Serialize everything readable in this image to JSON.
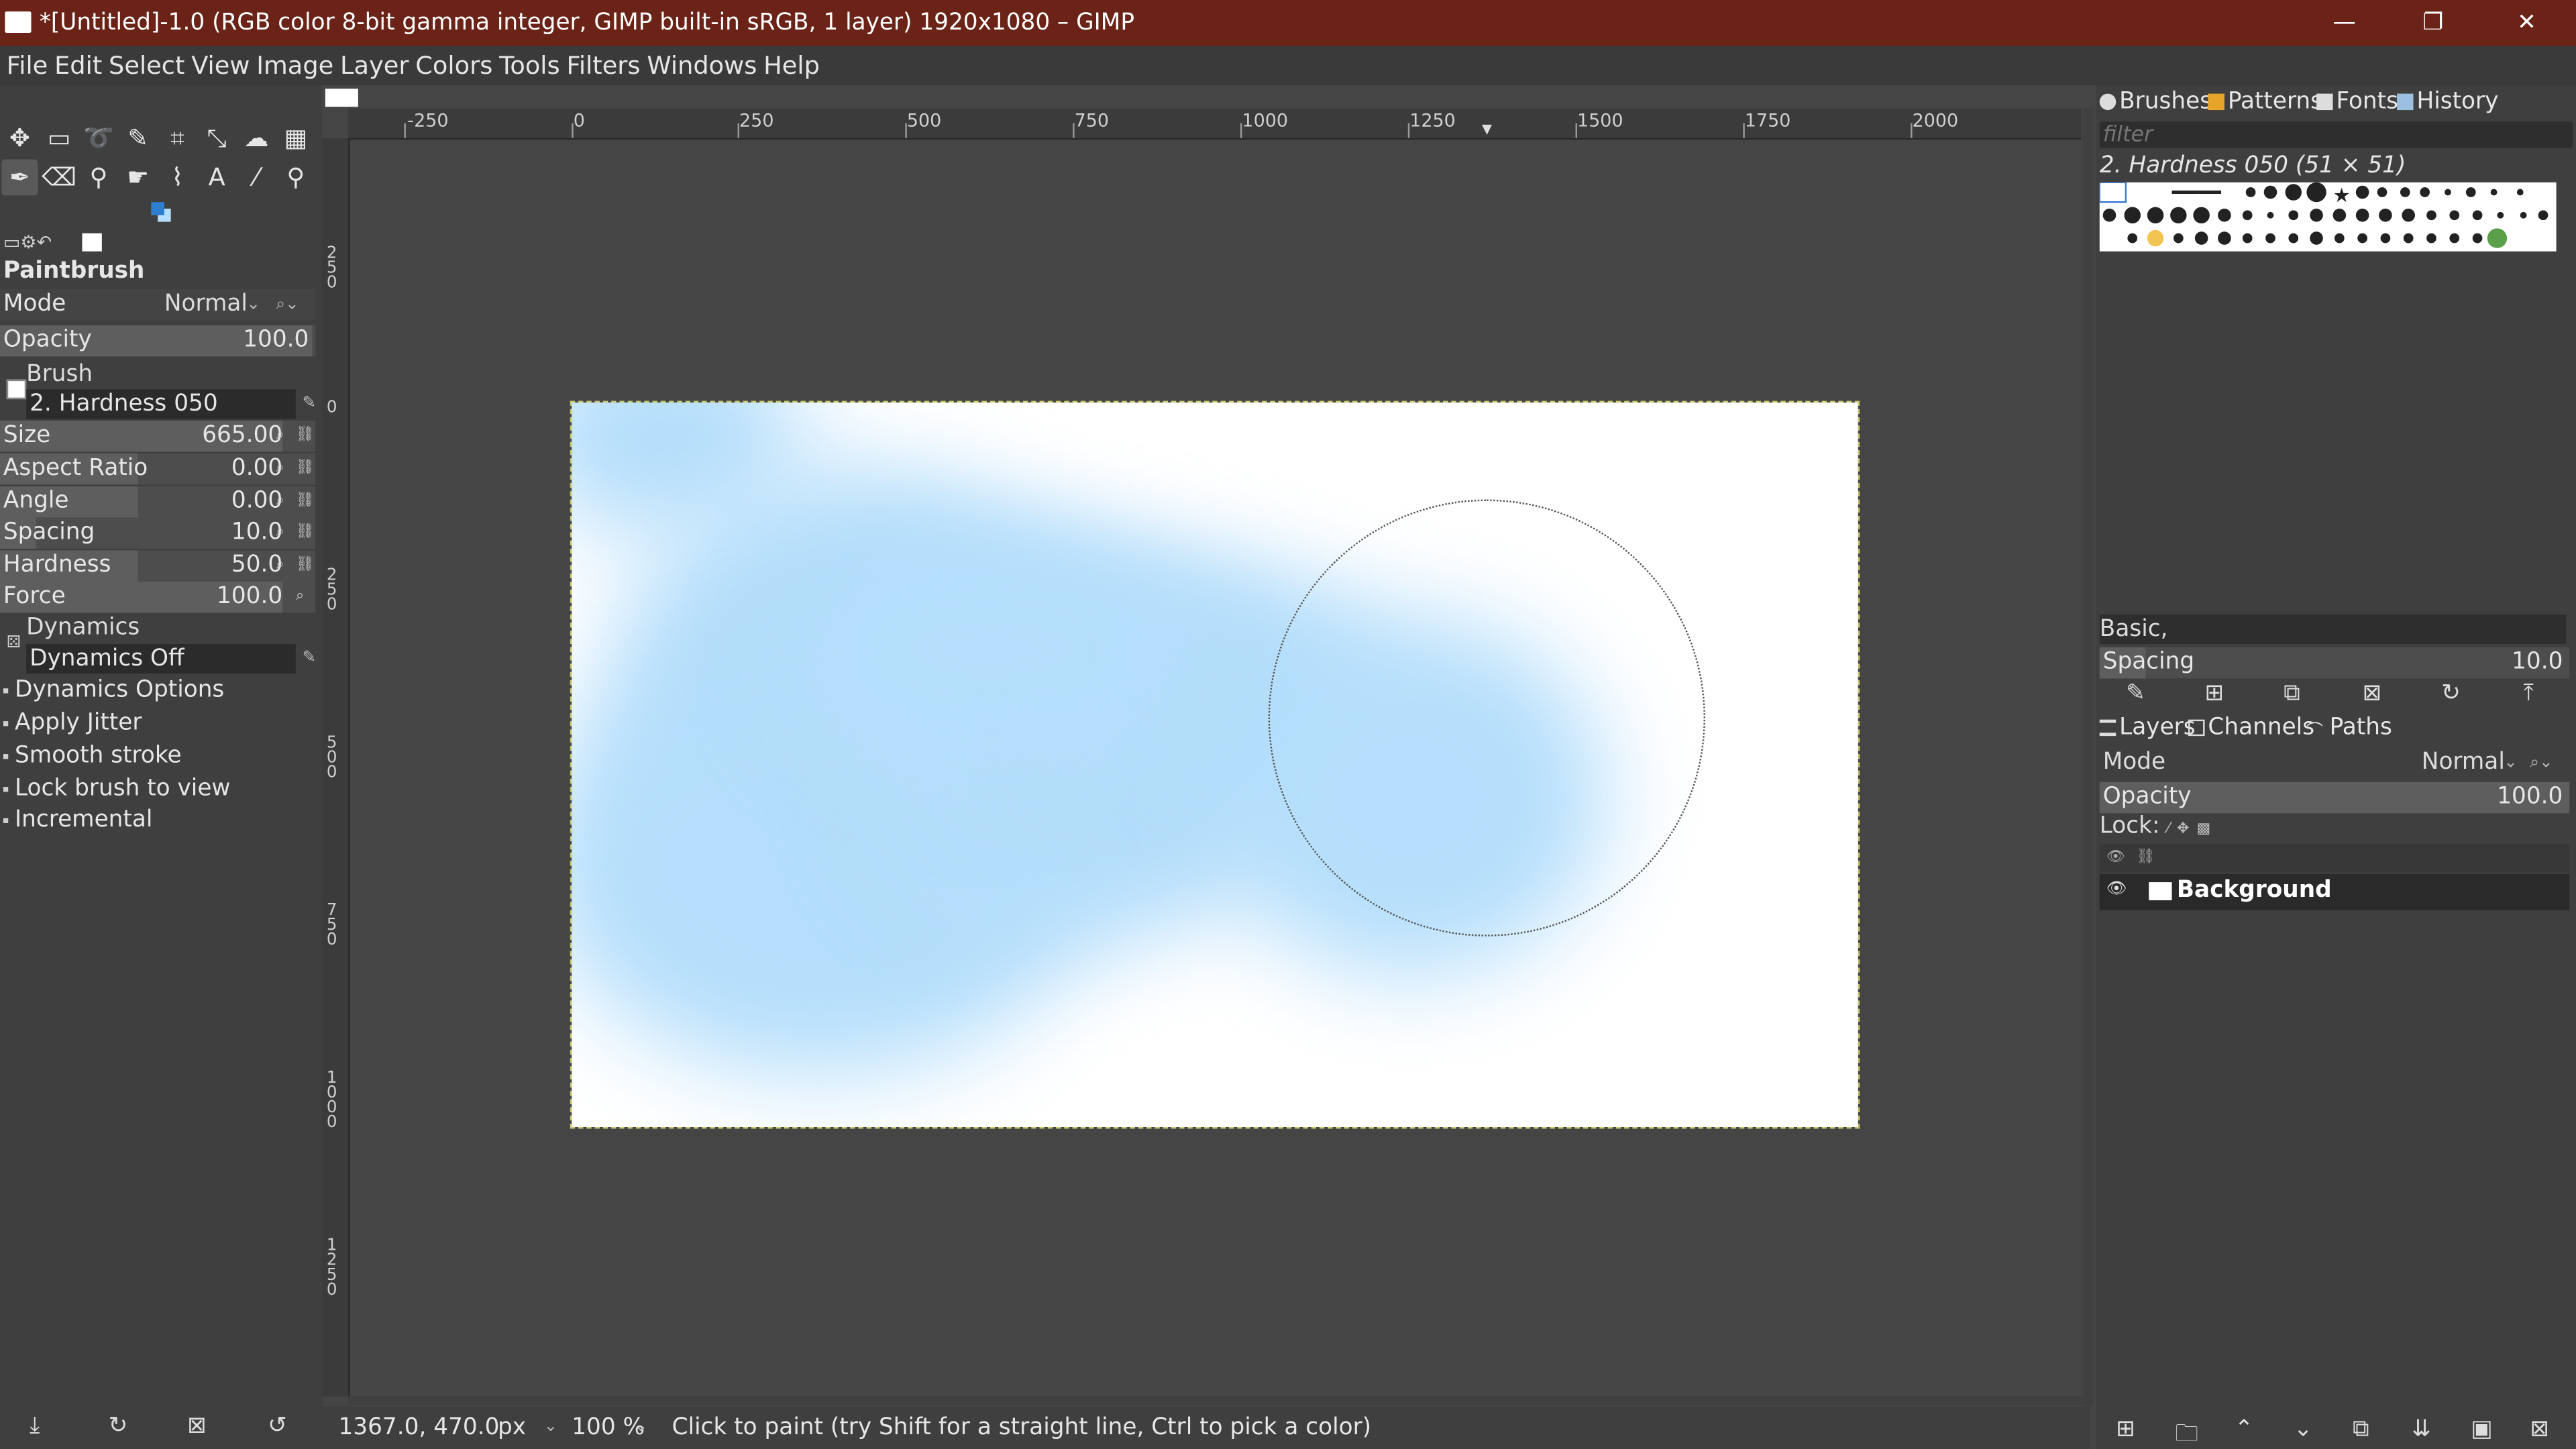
{
  "window": {
    "title": "*[Untitled]-1.0 (RGB color 8-bit gamma integer, GIMP built-in sRGB, 1 layer) 1920x1080 – GIMP",
    "minimize": "—",
    "restore": "❐",
    "close": "✕"
  },
  "menu": [
    "File",
    "Edit",
    "Select",
    "View",
    "Image",
    "Layer",
    "Colors",
    "Tools",
    "Filters",
    "Windows",
    "Help"
  ],
  "toolbox": {
    "tools_row1": [
      {
        "name": "move-tool-icon",
        "glyph": "✥"
      },
      {
        "name": "rect-select-icon",
        "glyph": "▭"
      },
      {
        "name": "lasso-icon",
        "glyph": "➰"
      },
      {
        "name": "fuzzy-select-icon",
        "glyph": "✎"
      },
      {
        "name": "crop-icon",
        "glyph": "⌗"
      },
      {
        "name": "scale-icon",
        "glyph": "⤡"
      },
      {
        "name": "warp-icon",
        "glyph": "☁"
      },
      {
        "name": "gradient-icon",
        "glyph": "▦"
      }
    ],
    "tools_row2": [
      {
        "name": "paintbrush-icon",
        "glyph": "✒"
      },
      {
        "name": "eraser-icon",
        "glyph": "⌫"
      },
      {
        "name": "clone-icon",
        "glyph": "⚲"
      },
      {
        "name": "smudge-icon",
        "glyph": "☛"
      },
      {
        "name": "paths-icon",
        "glyph": "⌇"
      },
      {
        "name": "text-icon",
        "glyph": "A"
      },
      {
        "name": "color-picker-icon",
        "glyph": "⁄"
      },
      {
        "name": "zoom-icon",
        "glyph": "⚲"
      }
    ],
    "accent_fg": "#2f7fd0",
    "accent_bg": "#b4defb"
  },
  "tool_options": {
    "title": "Paintbrush",
    "mode_label": "Mode",
    "mode_value": "Normal",
    "opacity_label": "Opacity",
    "opacity_value": "100.0",
    "brush_label": "Brush",
    "brush_value": "2. Hardness 050",
    "size_label": "Size",
    "size_value": "665.00",
    "aspect_label": "Aspect Ratio",
    "aspect_value": "0.00",
    "angle_label": "Angle",
    "angle_value": "0.00",
    "spacing_label": "Spacing",
    "spacing_value": "10.0",
    "hardness_label": "Hardness",
    "hardness_value": "50.0",
    "force_label": "Force",
    "force_value": "100.0",
    "dynamics_label": "Dynamics",
    "dynamics_value": "Dynamics Off",
    "options": [
      "Dynamics Options",
      "Apply Jitter",
      "Smooth stroke",
      "Lock brush to view",
      "Incremental"
    ]
  },
  "ruler": {
    "h_labels": [
      "-250",
      "0",
      "250",
      "500",
      "750",
      "1000",
      "1250",
      "1500",
      "1750",
      "2000"
    ],
    "v_labels": [
      "2 5 0",
      "0",
      "2 5 0",
      "5 0 0",
      "7 5 0",
      "1 0 0 0",
      "1 2 5 0"
    ]
  },
  "status": {
    "coords": "1367.0, 470.0",
    "unit": "px",
    "zoom": "100 %",
    "message": "Click to paint (try Shift for a straight line, Ctrl to pick a color)"
  },
  "brushes_panel": {
    "tabs": [
      "Brushes",
      "Patterns",
      "Fonts",
      "History"
    ],
    "filter_placeholder": "filter",
    "selected_brush": "2. Hardness 050 (51 × 51)",
    "tag_value": "Basic,",
    "spacing_label": "Spacing",
    "spacing_value": "10.0"
  },
  "layers_panel": {
    "tabs": [
      "Layers",
      "Channels",
      "Paths"
    ],
    "mode_label": "Mode",
    "mode_value": "Normal",
    "opacity_label": "Opacity",
    "opacity_value": "100.0",
    "lock_label": "Lock:",
    "layers": [
      {
        "name": "Background"
      }
    ]
  },
  "paint": {
    "color": "#b4defb"
  }
}
